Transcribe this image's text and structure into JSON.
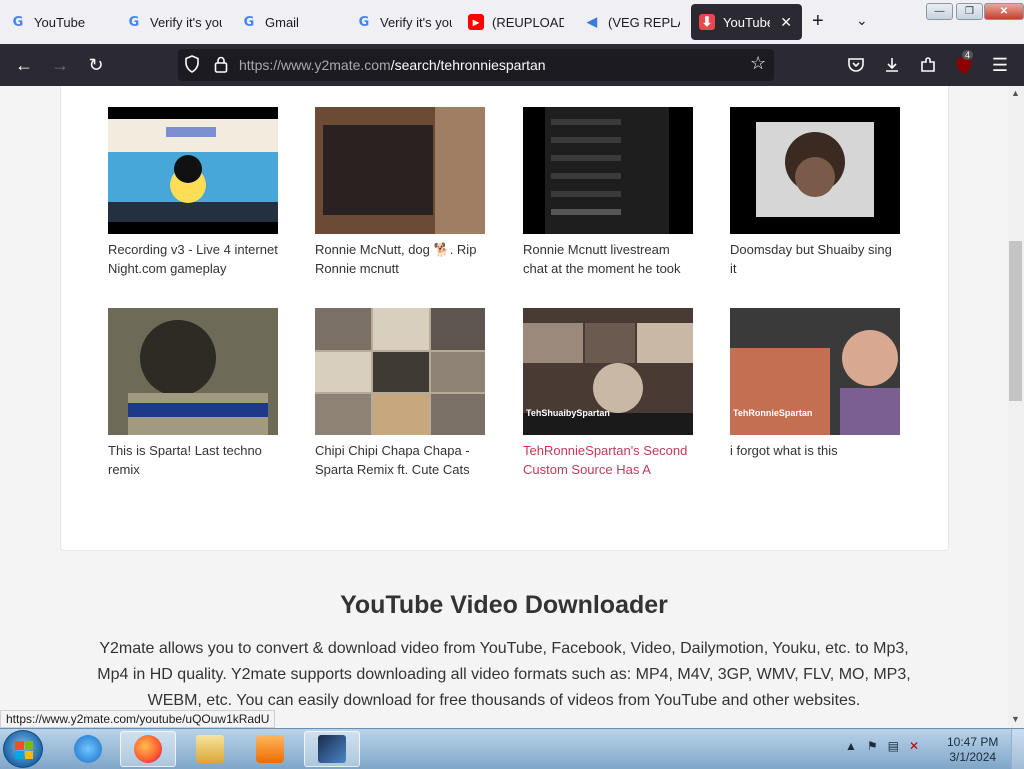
{
  "tabs": [
    {
      "title": "YouTube",
      "favicon": "google-icon",
      "active": false
    },
    {
      "title": "Verify it's you",
      "favicon": "google-icon",
      "active": false
    },
    {
      "title": "Gmail",
      "favicon": "google-icon",
      "active": false
    },
    {
      "title": "Verify it's you",
      "favicon": "google-icon",
      "active": false
    },
    {
      "title": "(REUPLOAD) |",
      "favicon": "youtube-icon",
      "active": false
    },
    {
      "title": "(VEG REPLAC",
      "favicon": "veg-icon",
      "active": false
    },
    {
      "title": "YouTube D",
      "favicon": "download-icon",
      "active": true
    }
  ],
  "toolbar": {
    "new_tab": "+",
    "tab_list": "⌄",
    "url_host": "https://www.y2mate.com",
    "url_path": "/search/tehronniespartan",
    "extension_badge": "4",
    "menu": "☰"
  },
  "window_controls": {
    "minimize": "—",
    "maximize": "❐",
    "close": "✕"
  },
  "videos": [
    {
      "title": "Recording v3 - Live 4 internet Night.com gameplay",
      "thumb_label": "",
      "colors": [
        "#f2ecdf",
        "#47a7d8",
        "#ffdd55"
      ]
    },
    {
      "title": "Ronnie McNutt, dog 🐕. Rip Ronnie mcnutt",
      "thumb_label": "",
      "colors": [
        "#6b4a36",
        "#2a2220",
        "#a07e63"
      ]
    },
    {
      "title": "Ronnie Mcnutt livestream chat at the moment he took",
      "thumb_label": "",
      "colors": [
        "#1e1e1e",
        "#3a3a3a",
        "#555555"
      ]
    },
    {
      "title": "Doomsday but Shuaiby sing it",
      "thumb_label": "",
      "colors": [
        "#d6d6d6",
        "#3b2a22",
        "#7a5a48"
      ]
    },
    {
      "title": "This is Sparta! Last techno remix",
      "thumb_label": "",
      "colors": [
        "#6e6a58",
        "#2e2a24",
        "#a29a80"
      ]
    },
    {
      "title": "Chipi Chipi Chapa Chapa - Sparta Remix ft. Cute Cats",
      "thumb_label": "",
      "colors": [
        "#b6aa99",
        "#7a7066",
        "#d8cfbf"
      ]
    },
    {
      "title": "TehRonnieSpartan's Second Custom Source Has A",
      "thumb_label": "TehShuaibySpartan",
      "colors": [
        "#4a3a34",
        "#9b8a7b",
        "#c9b8a6"
      ]
    },
    {
      "title": "i forgot what is this",
      "thumb_label": "TehRonnieSpartan",
      "colors": [
        "#3a3a3a",
        "#c46e52",
        "#7c5f92"
      ]
    }
  ],
  "section": {
    "title": "YouTube Video Downloader",
    "description": "Y2mate allows you to convert & download video from YouTube, Facebook, Video, Dailymotion, Youku, etc. to Mp3, Mp4 in HD quality. Y2mate supports downloading all video formats such as: MP4, M4V, 3GP, WMV, FLV, MO, MP3, WEBM, etc. You can easily download for free thousands of videos from YouTube and other websites."
  },
  "status_url": "https://www.y2mate.com/youtube/uQOuw1kRadU",
  "taskbar": {
    "items": [
      "internet-explorer-icon",
      "firefox-icon",
      "file-explorer-icon",
      "media-player-icon",
      "video-editor-icon"
    ],
    "time": "10:47 PM",
    "date": "3/1/2024"
  }
}
